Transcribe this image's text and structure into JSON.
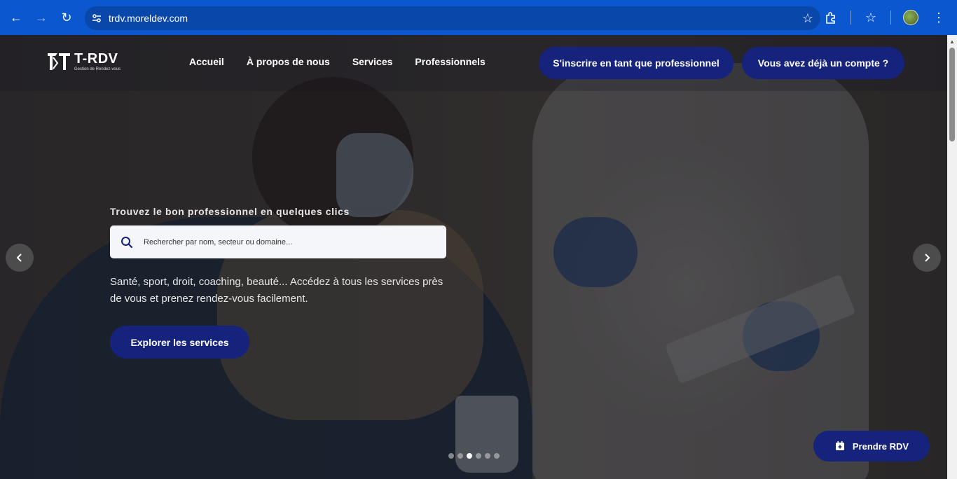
{
  "browser": {
    "url": "trdv.moreldev.com"
  },
  "nav": {
    "logo_title": "T-RDV",
    "logo_subtitle": "Gestion de Rendez-vous",
    "links": [
      "Accueil",
      "À propos de nous",
      "Services",
      "Professionnels"
    ],
    "signup_pro": "S'inscrire en tant que professionnel",
    "login": "Vous avez déjà un compte ?"
  },
  "hero": {
    "tagline": "Trouvez le bon professionnel en quelques clics",
    "search_placeholder": "Rechercher par nom, secteur ou domaine...",
    "description": "Santé, sport, droit, coaching, beauté... Accédez à tous les services près de vous et prenez rendez-vous facilement.",
    "cta": "Explorer les services"
  },
  "carousel": {
    "slide_count": 6,
    "active_index": 2
  },
  "floating": {
    "rdv_label": "Prendre RDV"
  },
  "colors": {
    "chrome": "#0b57d0",
    "primary": "#16237d"
  }
}
